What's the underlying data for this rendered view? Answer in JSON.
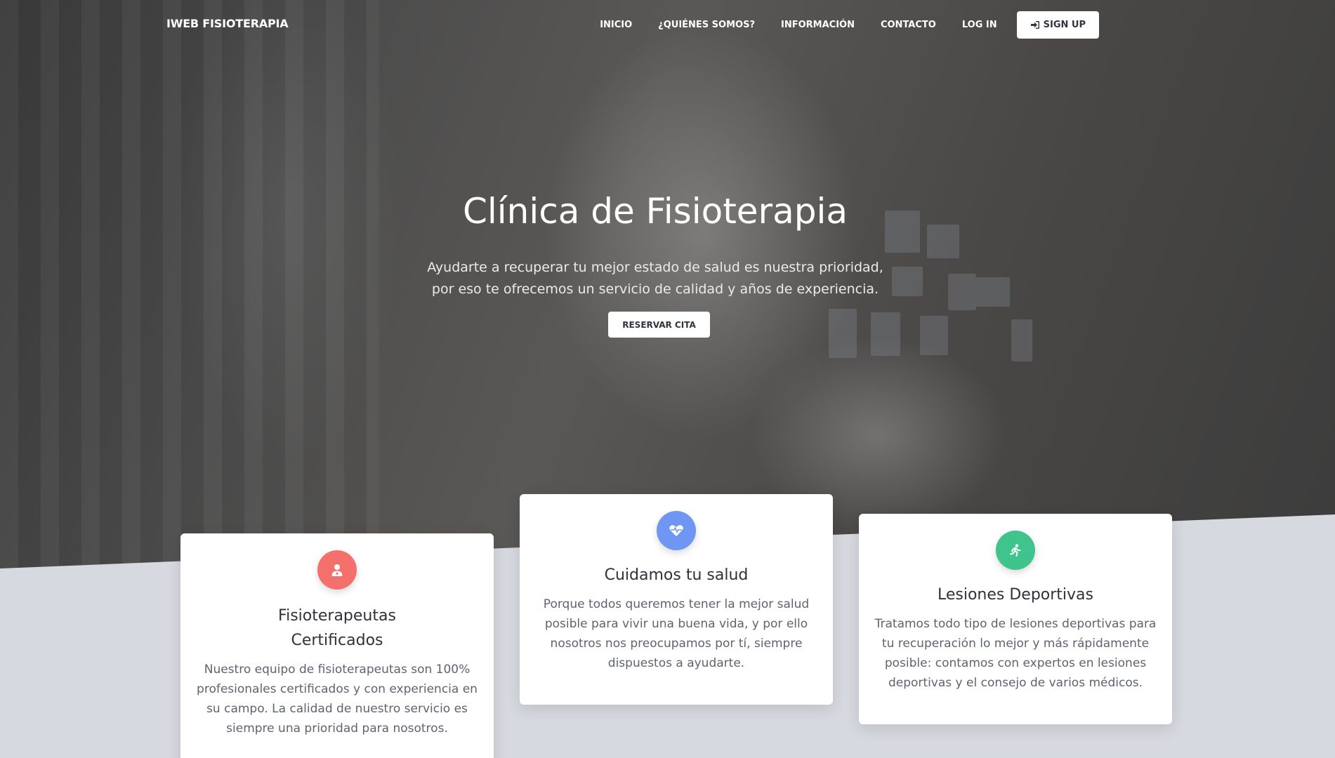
{
  "navbar": {
    "brand": "IWEB FISIOTERAPIA",
    "links": [
      "INICIO",
      "¿QUIÉNES SOMOS?",
      "INFORMACIÓN",
      "CONTACTO",
      "LOG IN"
    ],
    "signup_label": "SIGN UP",
    "signup_icon": "sign-in-icon"
  },
  "hero": {
    "title": "Clínica de Fisioterapia",
    "subtitle_line1": "Ayudarte a recuperar tu mejor estado de salud es nuestra prioridad,",
    "subtitle_line2": "por eso te ofrecemos un servicio de calidad y años de experiencia.",
    "cta_label": "RESERVAR CITA"
  },
  "cards": [
    {
      "icon": "user-doctor-icon",
      "color": "#f5706c",
      "title_line1": "Fisioterapeutas",
      "title_line2": "Certificados",
      "text": "Nuestro equipo de fisioterapeutas son 100% profesionales certificados y con experiencia en su campo. La calidad de nuestro servicio es siempre una prioridad para nosotros."
    },
    {
      "icon": "heartbeat-icon",
      "color": "#6f96f2",
      "title": "Cuidamos tu salud",
      "text": "Porque todos queremos tener la mejor salud posible para vivir una buena vida, y por ello nosotros nos preocupamos por tí, siempre dispuestos a ayudarte."
    },
    {
      "icon": "running-icon",
      "color": "#3ec48c",
      "title": "Lesiones Deportivas",
      "text": "Tratamos todo tipo de lesiones deportivas para tu recuperación lo mejor y más rápidamente posible: contamos con expertos en lesiones deportivas y el consejo de varios médicos."
    }
  ],
  "colors": {
    "page_background": "#d7d9e0",
    "text_dark": "#2f323a",
    "text_muted": "#5e6370"
  }
}
